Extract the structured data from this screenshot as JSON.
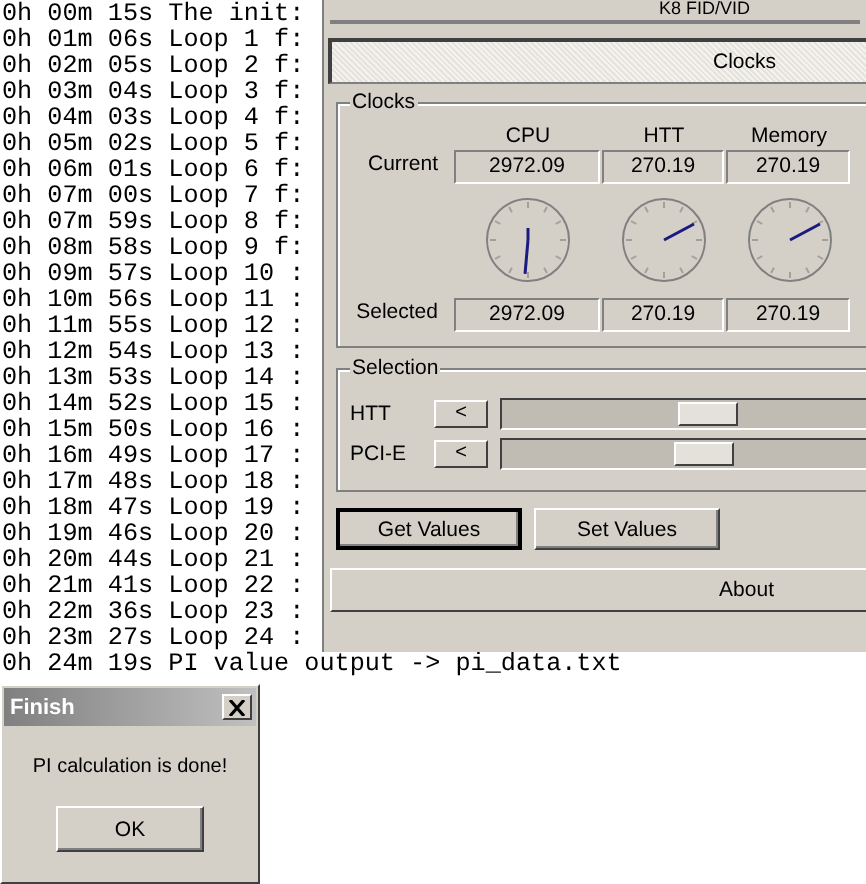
{
  "console": {
    "lines": [
      "0h 00m 15s The init:",
      "0h 01m 06s Loop 1 f:",
      "0h 02m 05s Loop 2 f:",
      "0h 03m 04s Loop 3 f:",
      "0h 04m 03s Loop 4 f:",
      "0h 05m 02s Loop 5 f:",
      "0h 06m 01s Loop 6 f:",
      "0h 07m 00s Loop 7 f:",
      "0h 07m 59s Loop 8 f:",
      "0h 08m 58s Loop 9 f:",
      "0h 09m 57s Loop 10 :",
      "0h 10m 56s Loop 11 :",
      "0h 11m 55s Loop 12 :",
      "0h 12m 54s Loop 13 :",
      "0h 13m 53s Loop 14 :",
      "0h 14m 52s Loop 15 :",
      "0h 15m 50s Loop 16 :",
      "0h 16m 49s Loop 17 :",
      "0h 17m 48s Loop 18 :",
      "0h 18m 47s Loop 19 :",
      "0h 19m 46s Loop 20 :",
      "0h 20m 44s Loop 21 :",
      "0h 21m 41s Loop 22 :",
      "0h 22m 36s Loop 23 :",
      "0h 23m 27s Loop 24 :",
      "0h 24m 19s PI value output -> pi_data.txt"
    ]
  },
  "app": {
    "header": "K8 FID/VID",
    "section_bar": "Clocks",
    "clocks": {
      "title": "Clocks",
      "columns": [
        "CPU",
        "HTT",
        "Memory"
      ],
      "rows": [
        {
          "label": "Current",
          "values": [
            "2972.09",
            "270.19",
            "270.19"
          ]
        },
        {
          "label": "Selected",
          "values": [
            "2972.09",
            "270.19",
            "270.19"
          ]
        }
      ]
    },
    "selection": {
      "title": "Selection",
      "sliders": [
        {
          "label": "HTT",
          "button": "<",
          "level": 0.55
        },
        {
          "label": "PCI-E",
          "button": "<",
          "level": 0.54
        }
      ]
    },
    "buttons": [
      {
        "label": "Get Values",
        "focused": true
      },
      {
        "label": "Set Values",
        "focused": false
      }
    ],
    "about": "About"
  },
  "dialog": {
    "title": "Finish",
    "message": "PI calculation is done!",
    "button": "OK"
  }
}
